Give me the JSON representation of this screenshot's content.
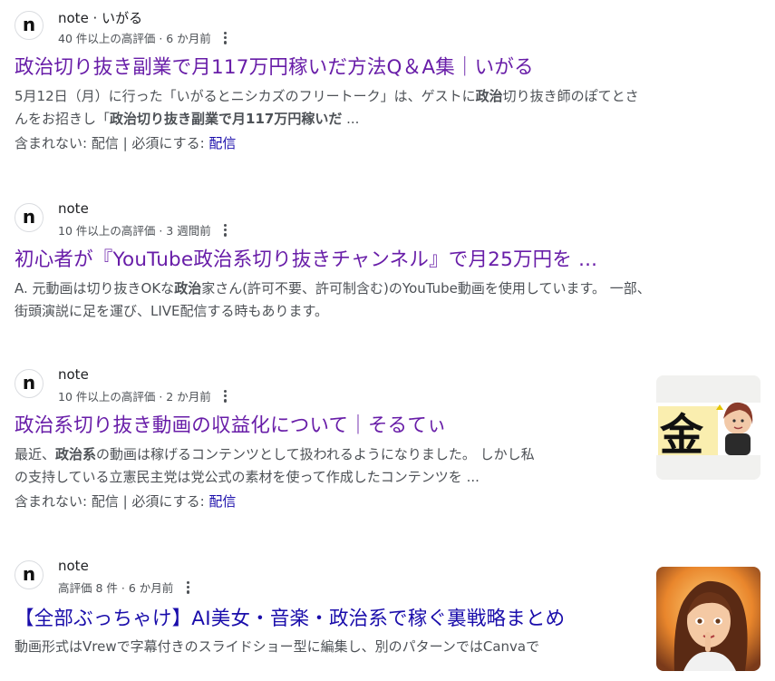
{
  "results": [
    {
      "site": "note · いがる",
      "meta": "40 件以上の高評価 · 6 か月前",
      "title": "政治切り抜き副業で月117万円稼いだ方法Q＆A集｜いがる",
      "snippet_l1_a": "5月12日（月）に行った「いがるとニシカズのフリートーク」は、ゲストに",
      "snippet_l1_b": "政治",
      "snippet_l1_c": "切り抜き師のぽてとさ",
      "snippet_l2_a": "んをお招きし「",
      "snippet_l2_b": "政治切り抜き副業で月117万円稼いだ",
      "snippet_l2_c": " ...",
      "missing_label": "含まれない: 配信 | 必須にする: ",
      "missing_link": "配信"
    },
    {
      "site": "note",
      "meta": "10 件以上の高評価 · 3 週間前",
      "title": "初心者が『YouTube政治系切り抜きチャンネル』で月25万円を ...",
      "snippet_l1_a": "A. 元動画は切り抜きOKな",
      "snippet_l1_b": "政治",
      "snippet_l1_c": "家さん(許可不要、許可制含む)のYouTube動画を使用しています。 一部、",
      "snippet_l2": "街頭演説に足を運び、LIVE配信する時もあります。"
    },
    {
      "site": "note",
      "meta": "10 件以上の高評価 · 2 か月前",
      "title": "政治系切り抜き動画の収益化について｜そるてぃ",
      "snippet_l1_a": "最近、",
      "snippet_l1_b": "政治系",
      "snippet_l1_c": "の動画は稼げるコンテンツとして扱われるようになりました。 しかし私",
      "snippet_l2": "の支持している立憲民主党は党公式の素材を使って作成したコンテンツを ...",
      "missing_label": "含まれない: 配信 | 必須にする: ",
      "missing_link": "配信",
      "thumb_text": "金"
    },
    {
      "site": "note",
      "meta": "高評価 8 件 · 6 か月前",
      "title": "【全部ぶっちゃけ】AI美女・音楽・政治系で稼ぐ裏戦略まとめ",
      "snippet_partial": "動画形式はVrewで字幕付きのスライドショー型に編集し、別のパターンではCanvaで"
    }
  ],
  "favicon_letter": "n",
  "colors": {
    "visited": "#681da8",
    "link": "#1a0dab",
    "text": "#4d5156"
  }
}
